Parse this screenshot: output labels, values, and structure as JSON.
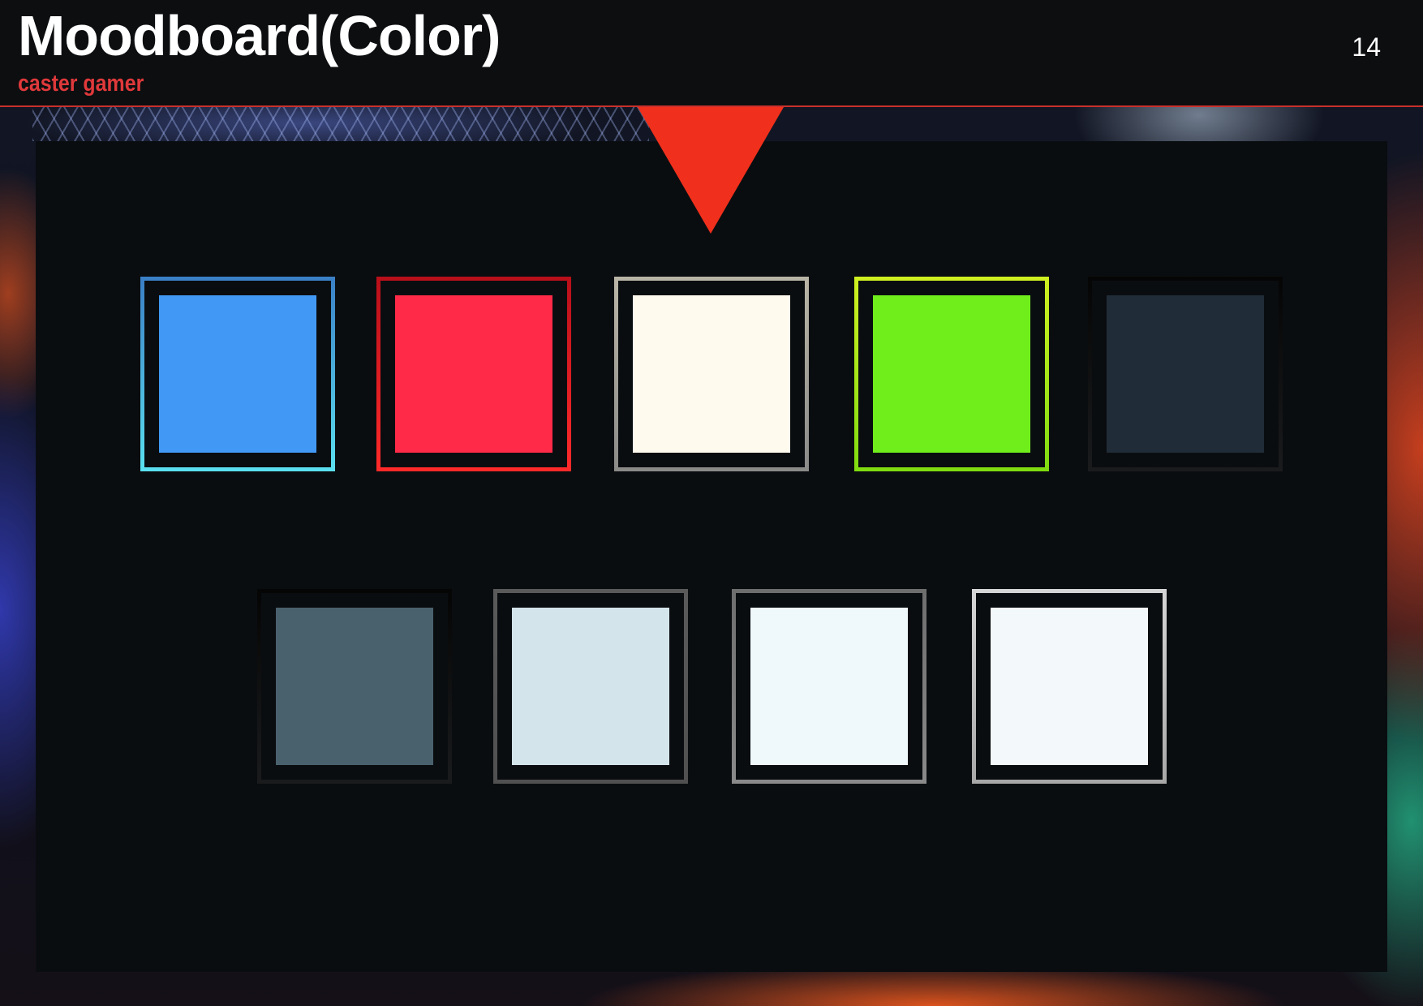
{
  "header": {
    "title": "Moodboard(Color)",
    "subtitle": "caster gamer",
    "page_number": "14"
  },
  "colors": {
    "accent_red": "#e0393b",
    "marker": "#f0301c",
    "panel_bg": "#0a0d10"
  },
  "swatches": [
    {
      "fill": "#4199f5",
      "frame": [
        "#3a7fc6",
        "#5be0f0"
      ]
    },
    {
      "fill": "#ff2a48",
      "frame": [
        "#b80f1a",
        "#ff2a2a"
      ]
    },
    {
      "fill": "#fefaee",
      "frame": [
        "#b9b4a6",
        "#8a8a88"
      ]
    },
    {
      "fill": "#70ee1c",
      "frame": [
        "#cfef20",
        "#7fdc10"
      ]
    },
    {
      "fill": "#202c37",
      "frame": [
        "#050505",
        "#1a1b1d"
      ]
    },
    {
      "fill": "#49616d",
      "frame": [
        "#050505",
        "#1a1b1d"
      ]
    },
    {
      "fill": "#d3e4ea",
      "frame": [
        "#5a5a5a",
        "#505050"
      ]
    },
    {
      "fill": "#eff8fb",
      "frame": [
        "#6e6e6e",
        "#8a8a8a"
      ]
    },
    {
      "fill": "#f3f9fb",
      "frame": [
        "#d6d6d6",
        "#a8a8a8"
      ]
    }
  ]
}
